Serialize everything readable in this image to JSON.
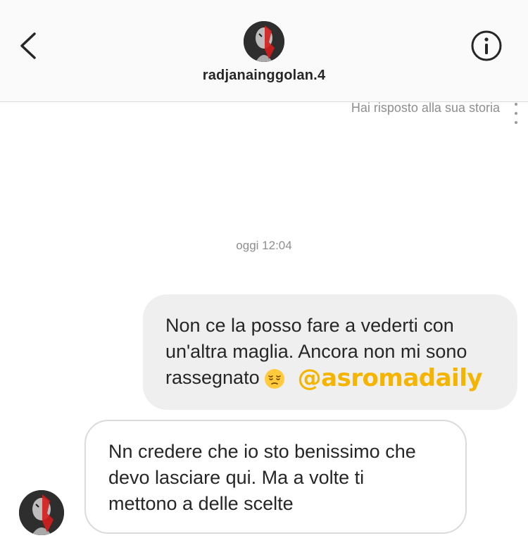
{
  "header": {
    "username": "radjanainggolan.4",
    "back_icon": "chevron-left-icon",
    "info_icon": "info-circle-icon",
    "avatar": "profile-avatar"
  },
  "thread": {
    "story_reply_note": "Hai risposto alla sua storia",
    "timestamp": "oggi 12:04",
    "sent_message": {
      "lines": [
        "Non ce la posso fare a vederti con",
        "un'altra maglia. Ancora non mi sono",
        "rassegnato"
      ],
      "emoji": "pensive-face-emoji",
      "tag": "@asromadaily",
      "tag_color": "#f5b400"
    },
    "received_message": {
      "lines": [
        "Nn credere che io sto benissimo che",
        "devo lasciare qui. Ma a volte ti",
        "mettono a delle scelte"
      ]
    }
  },
  "colors": {
    "header_bg": "#fafafa",
    "sent_bubble_bg": "#efefef",
    "received_bubble_border": "#dbdbdb",
    "muted_text": "#8e8e8e"
  }
}
